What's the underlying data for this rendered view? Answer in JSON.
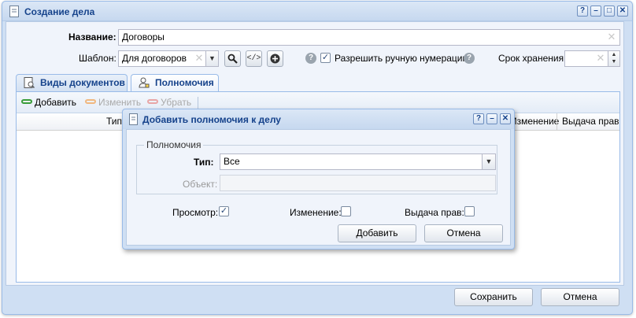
{
  "window": {
    "title": "Создание дела",
    "tools": {
      "help": "?",
      "minimize": "–",
      "maximize": "□",
      "close": "✕"
    }
  },
  "form": {
    "name_label": "Название:",
    "name_value": "Договоры",
    "template_label": "Шаблон:",
    "template_value": "Для договоров",
    "code_button": "</>",
    "manual_numbering_label": "Разрешить ручную нумерацию",
    "manual_numbering_checked": true,
    "retention_label": "Срок хранения:",
    "retention_value": ""
  },
  "tabs": [
    {
      "label": "Виды документов",
      "icon": "document-types-icon",
      "active": false
    },
    {
      "label": "Полномочия",
      "icon": "permissions-icon",
      "active": true
    }
  ],
  "toolbar": {
    "add": "Добавить",
    "edit": "Изменить",
    "remove": "Убрать"
  },
  "grid": {
    "columns": [
      "Тип",
      "Изменение",
      "Выдача прав"
    ]
  },
  "footer": {
    "save": "Сохранить",
    "cancel": "Отмена"
  },
  "dialog": {
    "title": "Добавить полномочия к делу",
    "tools": {
      "help": "?",
      "minimize": "–",
      "close": "✕"
    },
    "fieldset_legend": "Полномочия",
    "type_label": "Тип:",
    "type_value": "Все",
    "object_label": "Объект:",
    "object_value": "",
    "view_label": "Просмотр:",
    "view_checked": true,
    "change_label": "Изменение:",
    "change_checked": false,
    "grant_label": "Выдача прав:",
    "grant_checked": false,
    "add_button": "Добавить",
    "cancel_button": "Отмена"
  },
  "colors": {
    "header_text": "#15428b",
    "frame": "#99bbe8",
    "window_bg": "#cfdff3"
  }
}
